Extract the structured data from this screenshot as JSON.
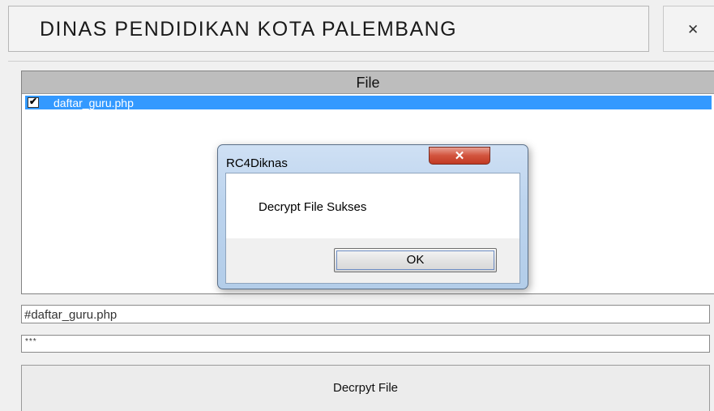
{
  "header": {
    "title": "DINAS PENDIDIKAN KOTA PALEMBANG",
    "close_label": "✕"
  },
  "file_list": {
    "column_header": "File",
    "items": [
      {
        "name": "daftar_guru.php",
        "checked": true,
        "selected": true
      }
    ]
  },
  "inputs": {
    "file_path_value": "#daftar_guru.php",
    "key_value": "***"
  },
  "actions": {
    "decrypt_label": "Decrpyt File"
  },
  "dialog": {
    "title": "RC4Diknas",
    "close_label": "✕",
    "message": "Decrypt File Sukses",
    "ok_label": "OK"
  },
  "colors": {
    "selection": "#3399ff",
    "header_bg": "#bdbdbd",
    "dialog_close": "#c94a33"
  }
}
